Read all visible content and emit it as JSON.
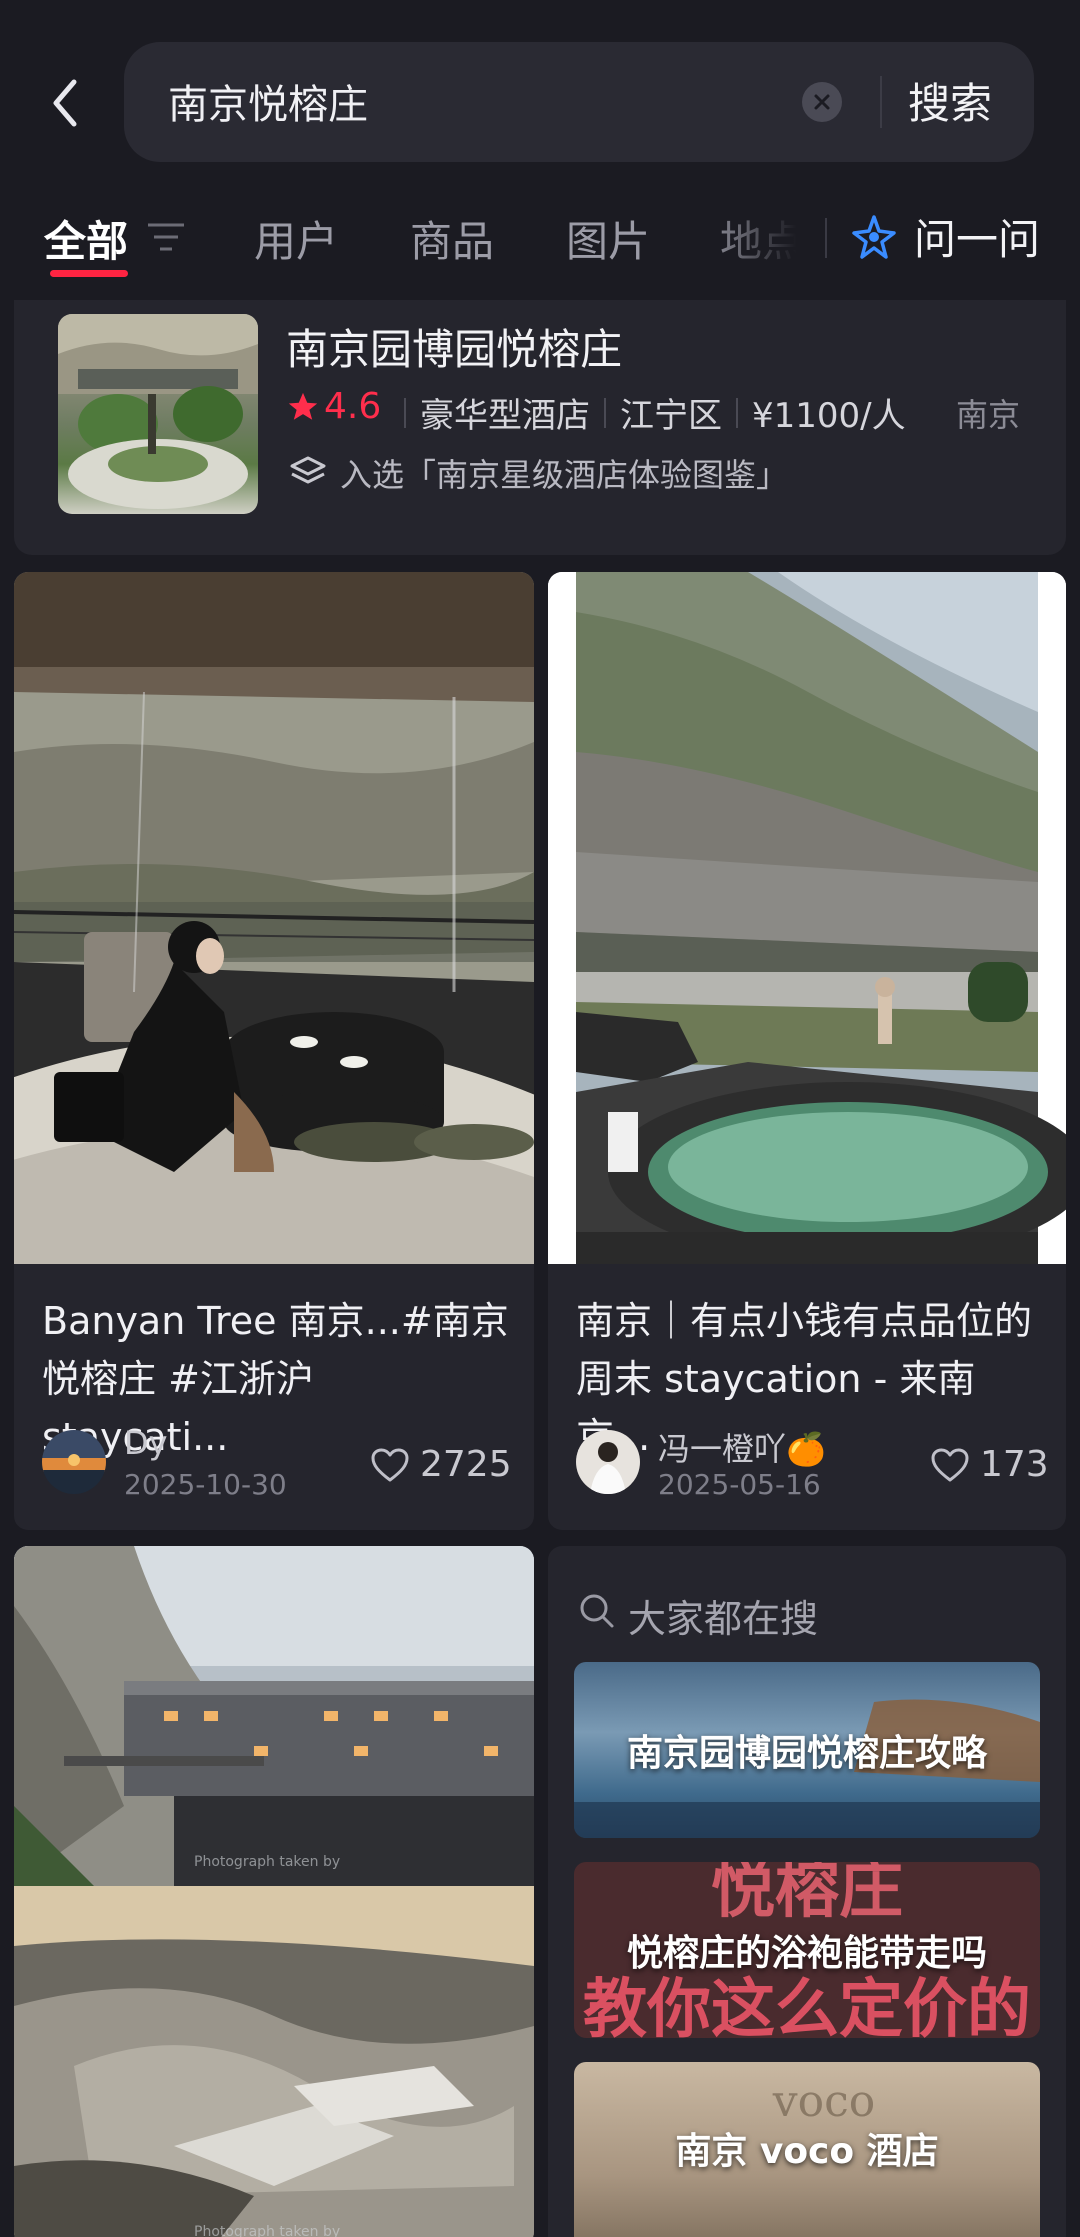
{
  "search": {
    "query": "南京悦榕庄",
    "button_label": "搜索"
  },
  "tabs": [
    {
      "label": "全部",
      "active": true
    },
    {
      "label": "用户"
    },
    {
      "label": "商品"
    },
    {
      "label": "图片"
    },
    {
      "label": "地点"
    }
  ],
  "ask_button": {
    "label": "问一问",
    "icon": "sparkle-icon"
  },
  "hotel": {
    "name": "南京园博园悦榕庄",
    "rating": "4.6",
    "type": "豪华型酒店",
    "district": "江宁区",
    "price": "¥1100/人",
    "city": "南京",
    "badge": "入选「南京星级酒店体验图鉴」"
  },
  "notes": [
    {
      "title": "Banyan Tree 南京...#南京悦榕庄 #江浙沪 staycati...",
      "author": "Dy",
      "date": "2025-10-30",
      "likes": "2725"
    },
    {
      "title": "南京｜有点小钱有点品位的周末 staycation - 来南京...",
      "author": "冯一橙吖🍊",
      "date": "2025-05-16",
      "likes": "173"
    }
  ],
  "photo_credit": "Photograph taken by",
  "popular": {
    "title": "大家都在搜",
    "items": [
      {
        "label": "南京园博园悦榕庄攻略"
      },
      {
        "label": "悦榕庄的浴袍能带走吗",
        "overlay_top": "悦榕庄",
        "overlay_bottom": "教你这么定价的"
      },
      {
        "label": "南京 voco 酒店",
        "overlay_sign": "voco"
      }
    ]
  },
  "colors": {
    "accent": "#ff2442",
    "rating": "#ff2e4c",
    "background": "#1b1b22",
    "card": "#25252d"
  }
}
